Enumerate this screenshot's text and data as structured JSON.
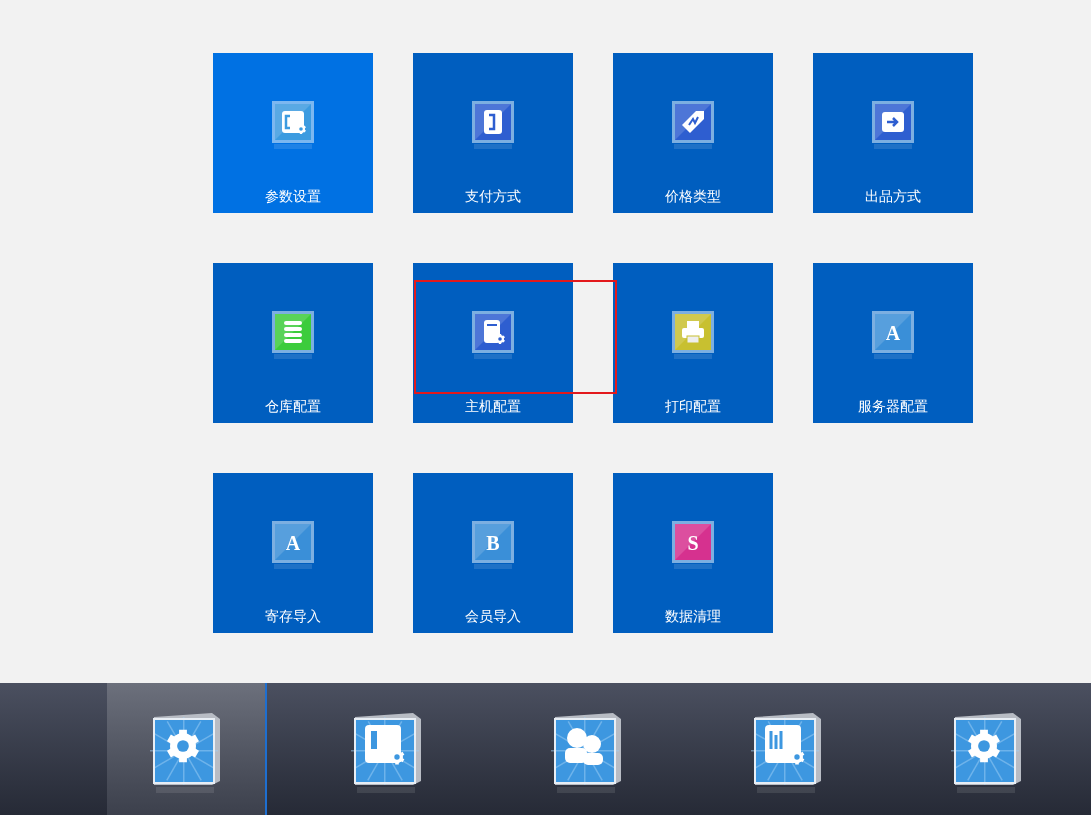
{
  "tiles": [
    {
      "label": "参数设置",
      "kind": "document",
      "hovered": true,
      "framed": false
    },
    {
      "label": "支付方式",
      "kind": "payment",
      "hovered": false,
      "framed": false
    },
    {
      "label": "价格类型",
      "kind": "tag",
      "hovered": false,
      "framed": false
    },
    {
      "label": "出品方式",
      "kind": "exit",
      "hovered": false,
      "framed": false
    },
    {
      "label": "仓库配置",
      "kind": "stack",
      "hovered": false,
      "framed": false
    },
    {
      "label": "主机配置",
      "kind": "server",
      "hovered": false,
      "framed": true
    },
    {
      "label": "打印配置",
      "kind": "printer",
      "hovered": false,
      "framed": false
    },
    {
      "label": "服务器配置",
      "kind": "letter",
      "glyph": "A",
      "color": "#3a8fd8",
      "hovered": false,
      "framed": false
    },
    {
      "label": "寄存导入",
      "kind": "letter",
      "glyph": "A",
      "color": "#3a8fd8",
      "hovered": false,
      "framed": false
    },
    {
      "label": "会员导入",
      "kind": "letter",
      "glyph": "B",
      "color": "#3a8fd8",
      "hovered": false,
      "framed": false
    },
    {
      "label": "数据清理",
      "kind": "letter",
      "glyph": "S",
      "color": "#d6318f",
      "hovered": false,
      "framed": false
    }
  ],
  "dock": [
    {
      "kind": "gear",
      "selected": true
    },
    {
      "kind": "board-gear",
      "selected": false
    },
    {
      "kind": "people",
      "selected": false
    },
    {
      "kind": "chart-gear",
      "selected": false
    },
    {
      "kind": "gear",
      "selected": false
    }
  ]
}
